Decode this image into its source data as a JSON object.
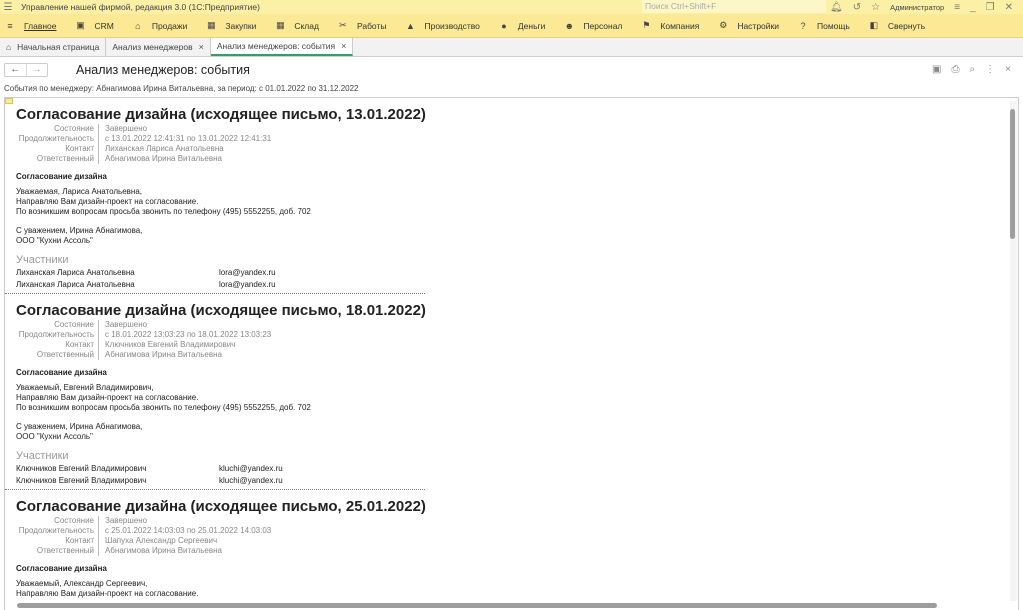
{
  "window": {
    "title": "Управление нашей фирмой, редакция 3.0  (1С:Предприятие)",
    "search_placeholder": "Поиск Ctrl+Shift+F",
    "user": "Администратор"
  },
  "menu": [
    {
      "label": "Главное",
      "icon": "≡"
    },
    {
      "label": "CRM",
      "icon": "▣"
    },
    {
      "label": "Продажи",
      "icon": "⌂"
    },
    {
      "label": "Закупки",
      "icon": "▦"
    },
    {
      "label": "Склад",
      "icon": "▦"
    },
    {
      "label": "Работы",
      "icon": "✂"
    },
    {
      "label": "Производство",
      "icon": "▲"
    },
    {
      "label": "Деньги",
      "icon": "●"
    },
    {
      "label": "Персонал",
      "icon": "☻"
    },
    {
      "label": "Компания",
      "icon": "⚑"
    },
    {
      "label": "Настройки",
      "icon": "⚙"
    },
    {
      "label": "Помощь",
      "icon": "?"
    },
    {
      "label": "Свернуть",
      "icon": "◧"
    }
  ],
  "tabs": [
    {
      "label": "Начальная страница"
    },
    {
      "label": "Анализ менеджеров"
    },
    {
      "label": "Анализ менеджеров: события"
    }
  ],
  "page": {
    "title": "Анализ менеджеров: события",
    "subtitle": "События по менеджеру: Абнагимова Ирина Витальевна, за период: с 01.01.2022 по 31.12.2022"
  },
  "labels": {
    "state": "Состояние",
    "duration": "Продолжительность",
    "contact": "Контакт",
    "responsible": "Ответственный",
    "participants": "Участники"
  },
  "events": [
    {
      "title": "Согласование дизайна (исходящее письмо, 13.01.2022)",
      "state": "Завершено",
      "duration": "с 13.01.2022 12:41:31 по 13.01.2022 12:41:31",
      "contact": "Лиханская Лариса Анатольевна",
      "responsible": "Абнагимова Ирина Витальевна",
      "subject": "Согласование дизайна",
      "body": "Уважаемая, Лариса Анатольевна,\nНаправляю Вам дизайн-проект на согласование.\nПо возникшим вопросам просьба звонить по телефону (495) 5552255, доб. 702\n\nС уважением, Ирина Абнагимова,\nООО \"Кухни Ассоль\"",
      "participants": [
        {
          "name": "Лиханская Лариса Анатольевна",
          "email": "lora@yandex.ru"
        },
        {
          "name": "Лиханская Лариса Анатольевна",
          "email": "lora@yandex.ru"
        }
      ]
    },
    {
      "title": "Согласование дизайна (исходящее письмо, 18.01.2022)",
      "state": "Завершено",
      "duration": "с 18.01.2022 13:03:23 по 18.01.2022 13:03:23",
      "contact": "Ключников Евгений Владимирович",
      "responsible": "Абнагимова Ирина Витальевна",
      "subject": "Согласование дизайна",
      "body": "Уважаемый, Евгений Владимирович,\nНаправляю Вам дизайн-проект на согласование.\nПо возникшим вопросам просьба звонить по телефону (495) 5552255, доб. 702\n\nС уважением, Ирина Абнагимова,\nООО \"Кухни Ассоль\"",
      "participants": [
        {
          "name": "Ключников Евгений Владимирович",
          "email": "kluchi@yandex.ru"
        },
        {
          "name": "Ключников Евгений Владимирович",
          "email": "kluchi@yandex.ru"
        }
      ]
    },
    {
      "title": "Согласование дизайна (исходящее письмо, 25.01.2022)",
      "state": "Завершено",
      "duration": "с 25.01.2022 14:03:03 по 25.01.2022 14:03:03",
      "contact": "Шапуха Александр Сергеевич",
      "responsible": "Абнагимова Ирина Витальевна",
      "subject": "Согласование дизайна",
      "body": "Уважаемый, Александр Сергеевич,\nНаправляю Вам дизайн-проект на согласование.",
      "participants": []
    }
  ]
}
